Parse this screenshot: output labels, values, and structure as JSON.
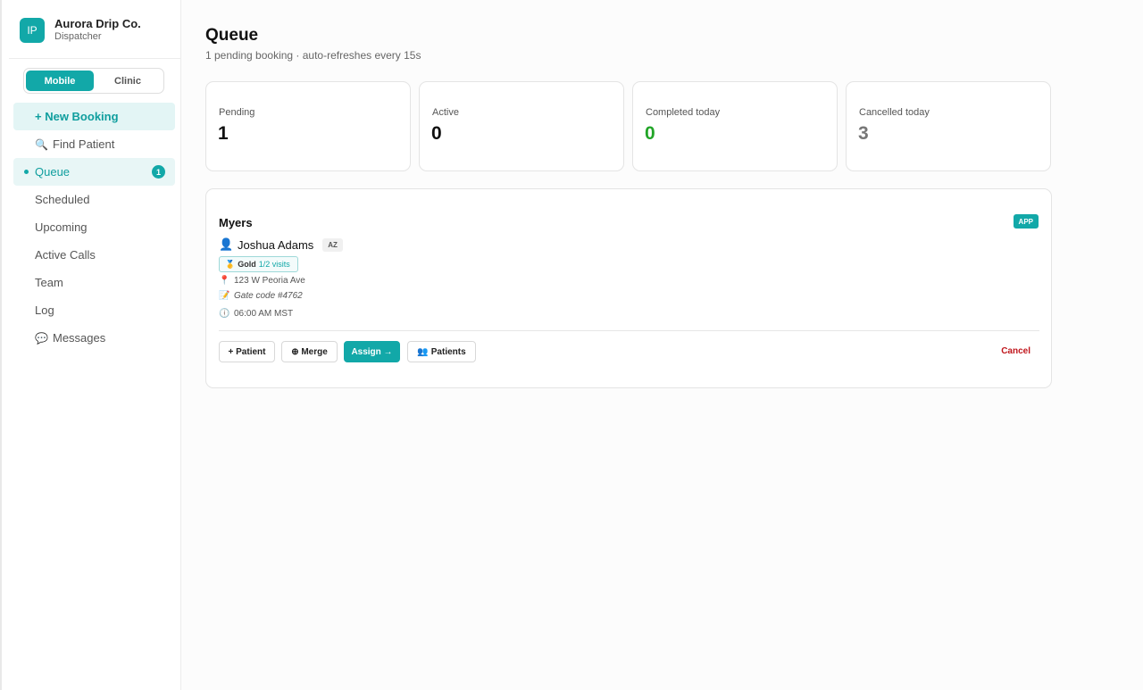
{
  "brand": {
    "logo": "IP",
    "name": "Aurora Drip Co.",
    "role": "Dispatcher"
  },
  "mode_toggle": {
    "options": [
      "Mobile",
      "Clinic"
    ],
    "selected": "Mobile"
  },
  "sidebar": {
    "new_booking": {
      "icon": "plus-icon",
      "label": "+ New Booking"
    },
    "items": [
      {
        "label": "Find Patient",
        "icon": "magnifier-icon"
      },
      {
        "label": "Queue",
        "badge": "1",
        "active": true
      },
      {
        "label": "Scheduled"
      },
      {
        "label": "Upcoming"
      },
      {
        "label": "Active Calls"
      },
      {
        "label": "Team"
      },
      {
        "label": "Log"
      },
      {
        "label": "Messages",
        "icon": "speech-bubble-icon"
      }
    ]
  },
  "header": {
    "title": "Queue",
    "subtitle": "1 pending booking · auto-refreshes every 15s"
  },
  "stats": [
    {
      "label": "Pending",
      "value": "1"
    },
    {
      "label": "Active",
      "value": "0"
    },
    {
      "label": "Completed today",
      "value": "0",
      "color": "#22a528"
    },
    {
      "label": "Cancelled today",
      "value": "3",
      "color": "#777777"
    }
  ],
  "booking": {
    "title": "Myers",
    "source_badge": "APP",
    "patient_name": "Joshua Adams",
    "state": "AZ",
    "loyalty": {
      "tier": "Gold",
      "visits": "1/2 visits"
    },
    "address": "123 W Peoria Ave",
    "note": "Gate code #4762",
    "time": "06:00 AM MST",
    "actions": {
      "add_patient": "+ Patient",
      "merge": "⊕ Merge",
      "assign": "Assign →",
      "patients": "Patients",
      "cancel": "Cancel"
    }
  },
  "colors": {
    "accent": "#12a8a8",
    "danger": "#c0161c",
    "success": "#22a528"
  }
}
